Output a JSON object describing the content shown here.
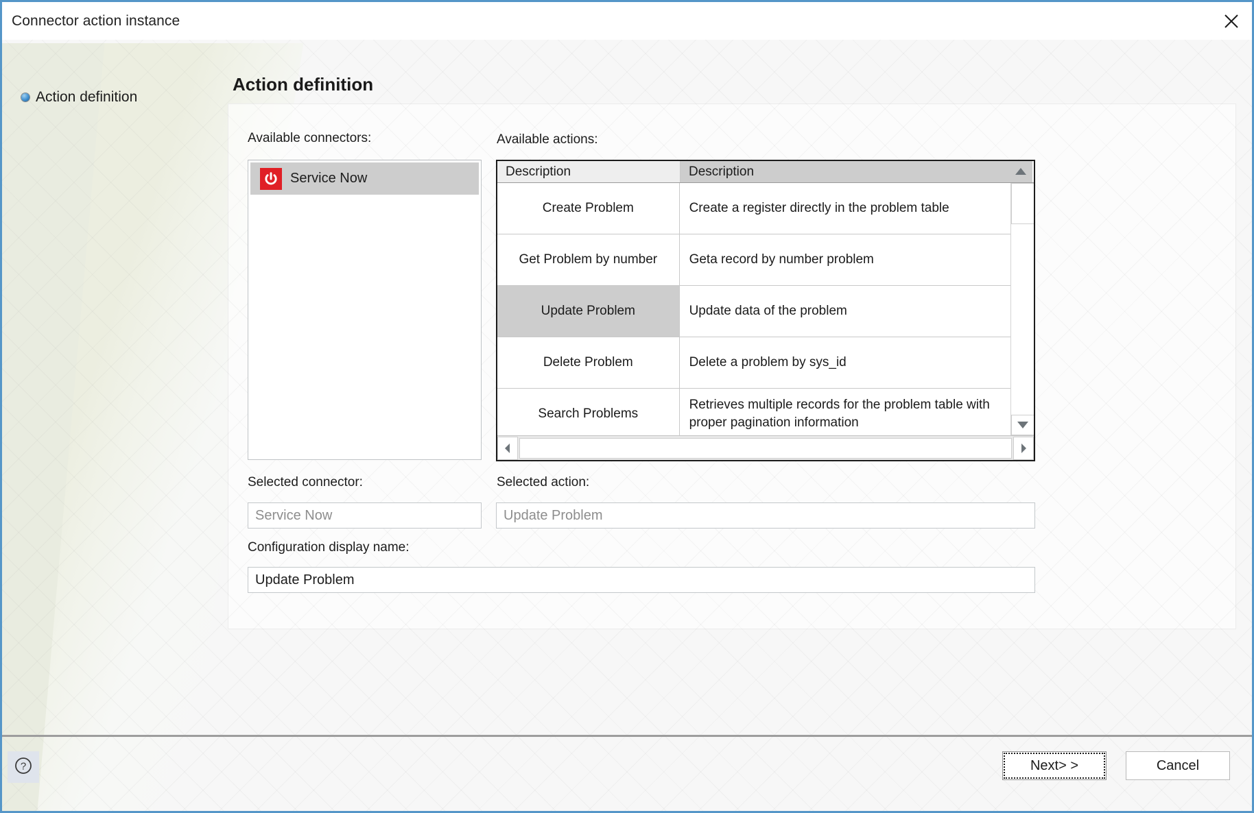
{
  "window": {
    "title": "Connector action instance",
    "close_icon": "close-icon"
  },
  "sidebar": {
    "items": [
      {
        "label": "Action definition",
        "icon": "bullet-sphere-icon",
        "selected": true
      }
    ]
  },
  "main": {
    "heading": "Action definition",
    "labels": {
      "available_connectors": "Available connectors:",
      "available_actions": "Available actions:",
      "selected_connector": "Selected connector:",
      "selected_action": "Selected action:",
      "configuration_display_name": "Configuration display name:"
    },
    "connectors": [
      {
        "label": "Service Now",
        "icon": "power-icon",
        "icon_color": "#e01f26",
        "selected": true
      }
    ],
    "actions_table": {
      "columns": [
        "Description",
        "Description"
      ],
      "rows": [
        {
          "name": "Create Problem",
          "description": "Create a register directly in the problem table",
          "selected": false
        },
        {
          "name": "Get Problem by number",
          "description": "Geta record by number problem",
          "selected": false
        },
        {
          "name": "Update Problem",
          "description": "Update data of the problem",
          "selected": true
        },
        {
          "name": "Delete Problem",
          "description": "Delete a problem by sys_id",
          "selected": false
        },
        {
          "name": "Search Problems",
          "description": "Retrieves multiple records for the problem table with proper pagination information",
          "selected": false
        }
      ]
    },
    "fields": {
      "selected_connector_value": "Service Now",
      "selected_action_value": "Update Problem",
      "configuration_display_name_value": "Update Problem"
    }
  },
  "footer": {
    "help_icon": "help-circle-icon",
    "next_label": "Next> >",
    "cancel_label": "Cancel"
  },
  "colors": {
    "title_border": "#5596c8",
    "accent_red": "#e01f26",
    "selection_gray": "#cdcdcd"
  }
}
